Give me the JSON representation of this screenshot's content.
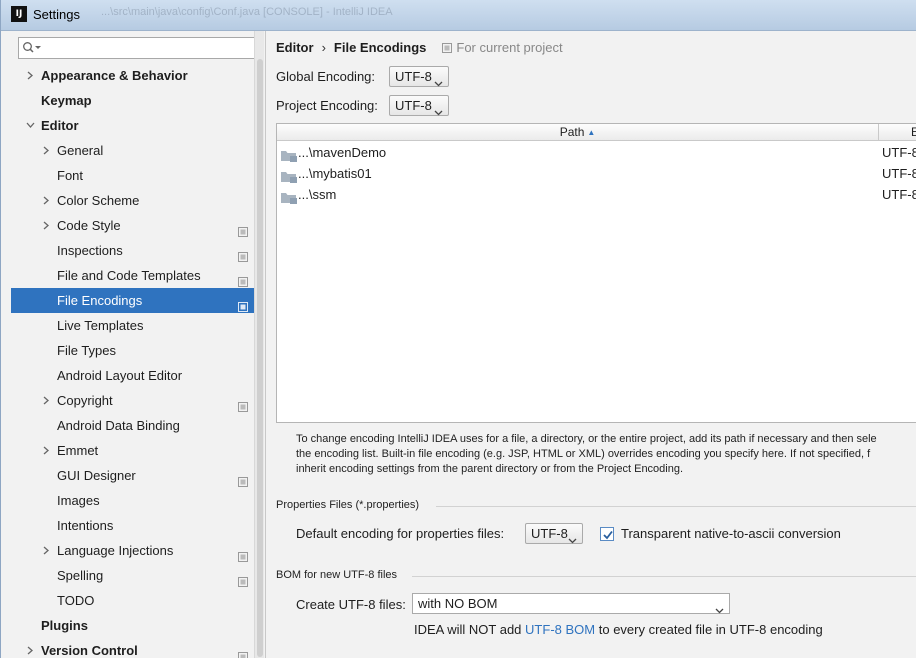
{
  "window": {
    "title": "Settings",
    "app_icon": "IJ",
    "ghost_title": "...\\src\\main\\java\\config\\Conf.java [CONSOLE] - IntelliJ IDEA"
  },
  "sidebar": {
    "search": {
      "value": "",
      "placeholder": ""
    },
    "items": [
      {
        "label": "Appearance & Behavior",
        "level": 0,
        "arrow": "right",
        "bold": true,
        "project_icon": false
      },
      {
        "label": "Keymap",
        "level": 0,
        "arrow": "none",
        "bold": true,
        "project_icon": false
      },
      {
        "label": "Editor",
        "level": 0,
        "arrow": "down",
        "bold": true,
        "project_icon": false
      },
      {
        "label": "General",
        "level": 1,
        "arrow": "right",
        "bold": false,
        "project_icon": false
      },
      {
        "label": "Font",
        "level": 1,
        "arrow": "none",
        "bold": false,
        "project_icon": false
      },
      {
        "label": "Color Scheme",
        "level": 1,
        "arrow": "right",
        "bold": false,
        "project_icon": false
      },
      {
        "label": "Code Style",
        "level": 1,
        "arrow": "right",
        "bold": false,
        "project_icon": true
      },
      {
        "label": "Inspections",
        "level": 1,
        "arrow": "none",
        "bold": false,
        "project_icon": true
      },
      {
        "label": "File and Code Templates",
        "level": 1,
        "arrow": "none",
        "bold": false,
        "project_icon": true
      },
      {
        "label": "File Encodings",
        "level": 1,
        "arrow": "none",
        "bold": false,
        "project_icon": true,
        "selected": true
      },
      {
        "label": "Live Templates",
        "level": 1,
        "arrow": "none",
        "bold": false,
        "project_icon": false
      },
      {
        "label": "File Types",
        "level": 1,
        "arrow": "none",
        "bold": false,
        "project_icon": false
      },
      {
        "label": "Android Layout Editor",
        "level": 1,
        "arrow": "none",
        "bold": false,
        "project_icon": false
      },
      {
        "label": "Copyright",
        "level": 1,
        "arrow": "right",
        "bold": false,
        "project_icon": true
      },
      {
        "label": "Android Data Binding",
        "level": 1,
        "arrow": "none",
        "bold": false,
        "project_icon": false
      },
      {
        "label": "Emmet",
        "level": 1,
        "arrow": "right",
        "bold": false,
        "project_icon": false
      },
      {
        "label": "GUI Designer",
        "level": 1,
        "arrow": "none",
        "bold": false,
        "project_icon": true
      },
      {
        "label": "Images",
        "level": 1,
        "arrow": "none",
        "bold": false,
        "project_icon": false
      },
      {
        "label": "Intentions",
        "level": 1,
        "arrow": "none",
        "bold": false,
        "project_icon": false
      },
      {
        "label": "Language Injections",
        "level": 1,
        "arrow": "right",
        "bold": false,
        "project_icon": true
      },
      {
        "label": "Spelling",
        "level": 1,
        "arrow": "none",
        "bold": false,
        "project_icon": true
      },
      {
        "label": "TODO",
        "level": 1,
        "arrow": "none",
        "bold": false,
        "project_icon": false
      },
      {
        "label": "Plugins",
        "level": 0,
        "arrow": "none",
        "bold": true,
        "project_icon": false
      },
      {
        "label": "Version Control",
        "level": 0,
        "arrow": "right",
        "bold": true,
        "project_icon": true
      }
    ]
  },
  "breadcrumb": {
    "section": "Editor",
    "separator": "›",
    "page": "File Encodings",
    "scope_hint": "For current project"
  },
  "global_encoding": {
    "label": "Global Encoding:",
    "value": "UTF-8"
  },
  "project_encoding": {
    "label": "Project Encoding:",
    "value": "UTF-8"
  },
  "table": {
    "columns": {
      "path": "Path",
      "encoding": "E"
    },
    "rows": [
      {
        "path": "...\\mavenDemo",
        "encoding": "UTF-8"
      },
      {
        "path": "...\\mybatis01",
        "encoding": "UTF-8"
      },
      {
        "path": "...\\ssm",
        "encoding": "UTF-8"
      }
    ]
  },
  "help_text": {
    "line1": "To change encoding IntelliJ IDEA uses for a file, a directory, or the entire project, add its path if necessary and then sele",
    "line2": "the encoding list. Built-in file encoding (e.g. JSP, HTML or XML) overrides encoding you specify here. If not specified, f",
    "line3": "inherit encoding settings from the parent directory or from the Project Encoding."
  },
  "properties": {
    "group_title": "Properties Files (*.properties)",
    "default_label": "Default encoding for properties files:",
    "default_value": "UTF-8",
    "native_to_ascii_label": "Transparent native-to-ascii conversion",
    "native_to_ascii_checked": true
  },
  "bom": {
    "group_title": "BOM for new UTF-8 files",
    "create_label": "Create UTF-8 files:",
    "create_value": "with NO BOM",
    "note_prefix": "IDEA will NOT add",
    "note_link": "UTF-8 BOM",
    "note_suffix": "to every created file in UTF-8 encoding"
  },
  "colors": {
    "selection": "#2f73bf",
    "link": "#2f73bf",
    "panel_bg": "#f2f2f2"
  },
  "icons": {
    "search": "search-icon",
    "tree_collapsed": "chevron-right-icon",
    "tree_expanded": "chevron-down-icon",
    "project_scope": "project-scope-icon",
    "folder": "module-folder-icon",
    "combo": "chevron-down-icon",
    "checkbox": "checkmark-icon"
  }
}
